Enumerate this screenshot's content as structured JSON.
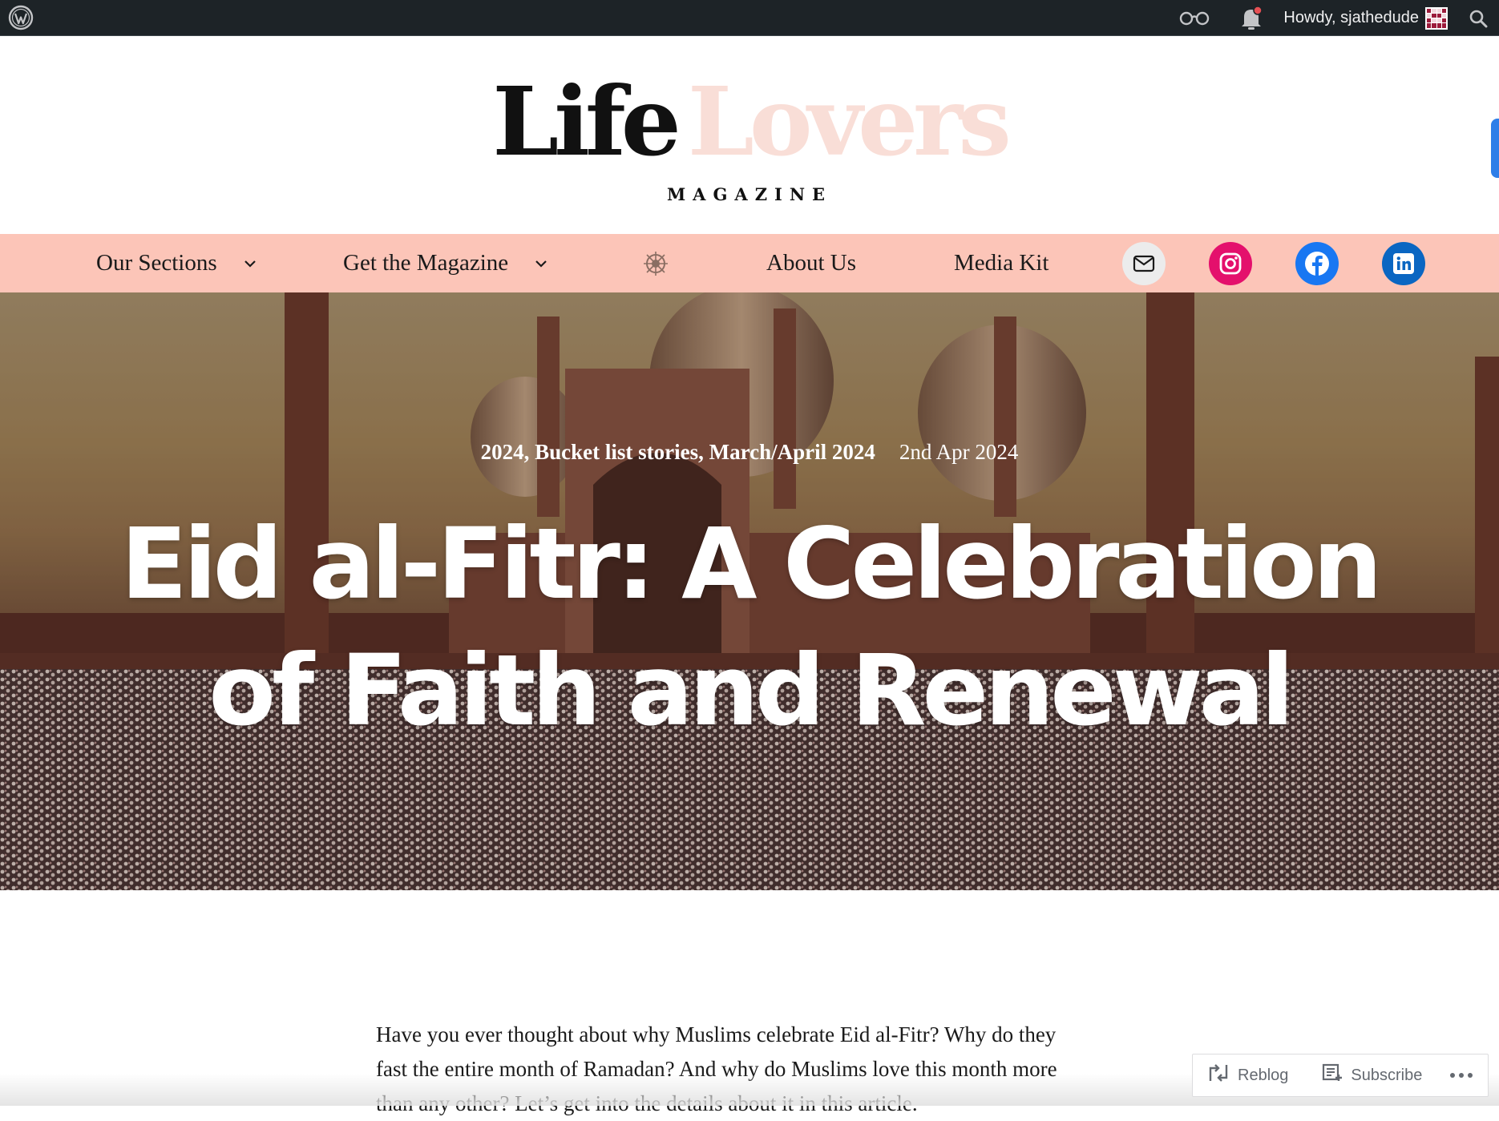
{
  "admin_bar": {
    "logo": "wordpress-icon",
    "reader_icon": "reader-glasses-icon",
    "notifications_icon": "bell-icon",
    "greeting": "Howdy, sjathedude",
    "search_icon": "search-icon"
  },
  "site": {
    "logo_word1": "Life",
    "logo_word2": "Lovers",
    "tagline": "MAGAZINE",
    "colors": {
      "logo_dark": "#111111",
      "logo_light": "#f9ded7",
      "nav_bg": "#fcc5b8"
    }
  },
  "nav": {
    "items": [
      {
        "label": "Our Sections",
        "has_dropdown": true
      },
      {
        "label": "Get the Magazine",
        "has_dropdown": true
      },
      {
        "label": "About Us",
        "has_dropdown": false
      },
      {
        "label": "Media Kit",
        "has_dropdown": false
      }
    ],
    "emblem_icon": "compass-emblem-icon",
    "social": [
      {
        "name": "mail-icon",
        "color": "#ececec"
      },
      {
        "name": "instagram-icon",
        "color": "#e4106c"
      },
      {
        "name": "facebook-icon",
        "color": "#1877f2"
      },
      {
        "name": "linkedin-icon",
        "color": "#0a66c2"
      }
    ]
  },
  "post": {
    "categories": "2024, Bucket list stories, March/April 2024",
    "date": "2nd Apr 2024",
    "title_line1": "Eid al-Fitr: A Celebration",
    "title_line2": "of Faith and Renewal",
    "intro_line1": "Have you ever thought about why Muslims celebrate Eid al-Fitr? Why do they",
    "intro_line2": "fast the entire month of Ramadan? And why do Muslims love this month more",
    "intro_line3": "than any other? Let’s get into the details about it in this article."
  },
  "action_bar": {
    "reblog_label": "Reblog",
    "subscribe_label": "Subscribe",
    "more_icon": "ellipsis-icon"
  }
}
